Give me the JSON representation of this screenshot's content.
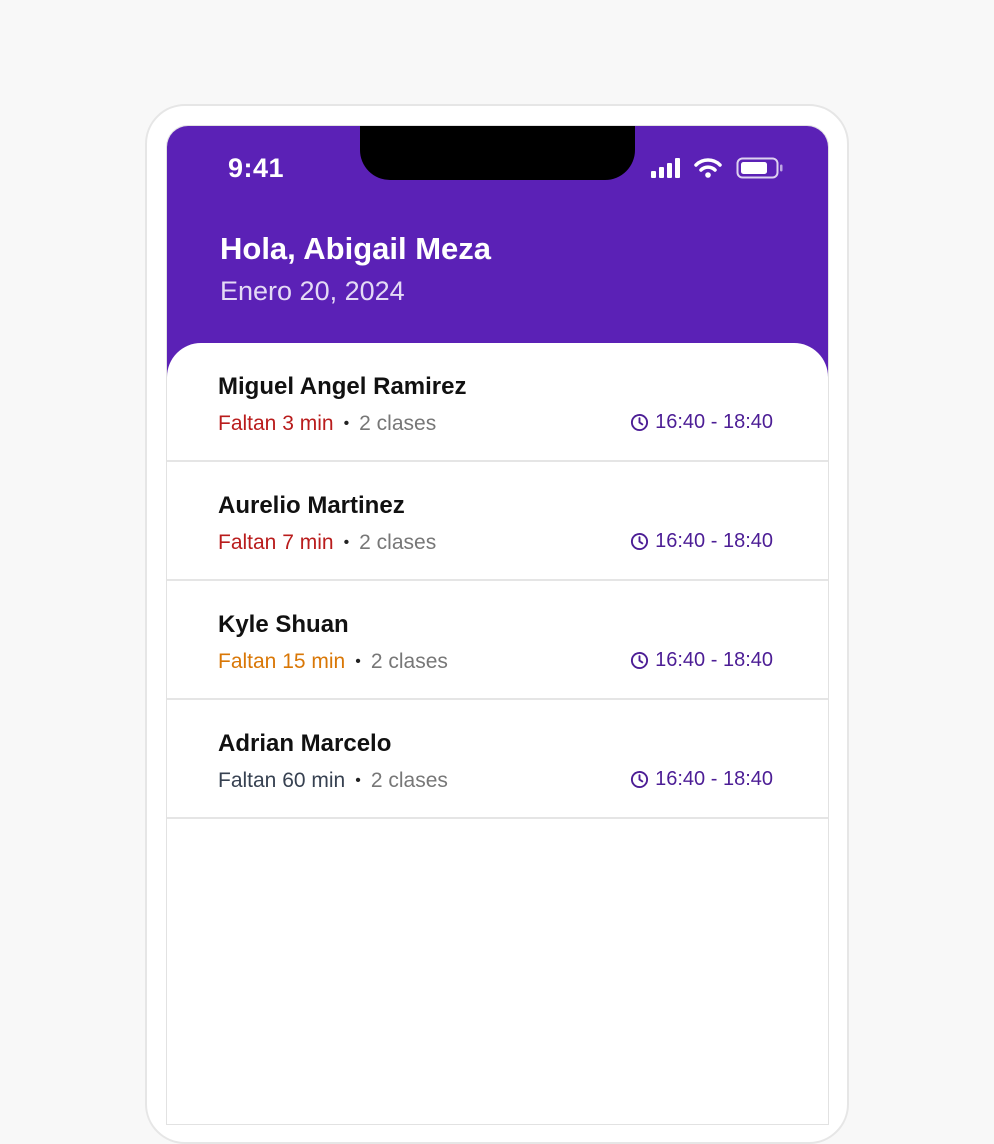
{
  "status_bar": {
    "time": "9:41",
    "icons": [
      "signal-icon",
      "wifi-icon",
      "battery-icon"
    ]
  },
  "header": {
    "greeting": "Hola, Abigail Meza",
    "date": "Enero 20, 2024"
  },
  "colors": {
    "primary": "#5b21b6",
    "urgent": "#b91c1c",
    "warning": "#d97706",
    "neutral": "#374151",
    "time_accent": "#4c1d95"
  },
  "appointments": [
    {
      "name": "Miguel Angel Ramirez",
      "remaining": "Faltan 3 min",
      "remaining_color": "#b91c1c",
      "classes": "2 clases",
      "time": "16:40 - 18:40"
    },
    {
      "name": "Aurelio Martinez",
      "remaining": "Faltan 7 min",
      "remaining_color": "#b91c1c",
      "classes": "2 clases",
      "time": "16:40 - 18:40"
    },
    {
      "name": "Kyle Shuan",
      "remaining": "Faltan 15 min",
      "remaining_color": "#d97706",
      "classes": "2 clases",
      "time": "16:40 - 18:40"
    },
    {
      "name": "Adrian Marcelo",
      "remaining": "Faltan 60 min",
      "remaining_color": "#374151",
      "classes": "2 clases",
      "time": "16:40 - 18:40"
    }
  ]
}
